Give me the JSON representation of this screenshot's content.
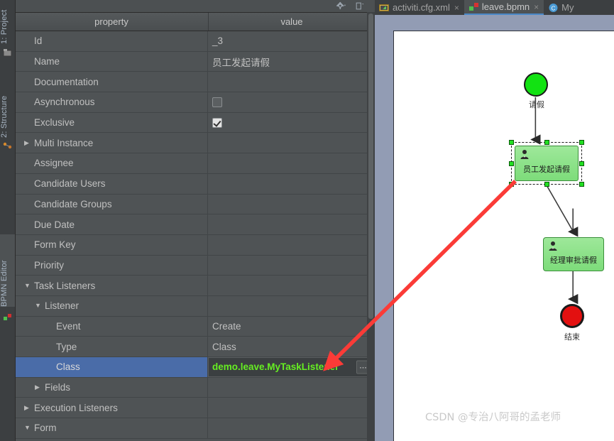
{
  "tool_strip": {
    "tabs": [
      {
        "label": "1: Project",
        "icon": "project-icon"
      },
      {
        "label": "2: Structure",
        "icon": "structure-icon"
      },
      {
        "label": "BPMN Editor",
        "icon": "bpmn-icon"
      }
    ]
  },
  "properties_panel": {
    "title_icons": [
      "gear-icon",
      "panel-layout-icon"
    ],
    "columns": {
      "property": "property",
      "value": "value"
    },
    "rows": [
      {
        "name": "Id",
        "value": "_3",
        "indent": 0,
        "twisty": "",
        "kind": "text"
      },
      {
        "name": "Name",
        "value": "员工发起请假",
        "indent": 0,
        "twisty": "",
        "kind": "text"
      },
      {
        "name": "Documentation",
        "value": "",
        "indent": 0,
        "twisty": "",
        "kind": "text"
      },
      {
        "name": "Asynchronous",
        "value": "",
        "indent": 0,
        "twisty": "",
        "kind": "checkbox-unchecked"
      },
      {
        "name": "Exclusive",
        "value": "",
        "indent": 0,
        "twisty": "",
        "kind": "checkbox-checked"
      },
      {
        "name": "Multi Instance",
        "value": "",
        "indent": 0,
        "twisty": "collapsed",
        "kind": "text"
      },
      {
        "name": "Assignee",
        "value": "",
        "indent": 0,
        "twisty": "",
        "kind": "text"
      },
      {
        "name": "Candidate Users",
        "value": "",
        "indent": 0,
        "twisty": "",
        "kind": "text"
      },
      {
        "name": "Candidate Groups",
        "value": "",
        "indent": 0,
        "twisty": "",
        "kind": "text"
      },
      {
        "name": "Due Date",
        "value": "",
        "indent": 0,
        "twisty": "",
        "kind": "text"
      },
      {
        "name": "Form Key",
        "value": "",
        "indent": 0,
        "twisty": "",
        "kind": "text"
      },
      {
        "name": "Priority",
        "value": "",
        "indent": 0,
        "twisty": "",
        "kind": "text"
      },
      {
        "name": "Task Listeners",
        "value": "",
        "indent": 0,
        "twisty": "expanded",
        "kind": "text"
      },
      {
        "name": "Listener",
        "value": "",
        "indent": 1,
        "twisty": "expanded",
        "kind": "text"
      },
      {
        "name": "Event",
        "value": "Create",
        "indent": 2,
        "twisty": "",
        "kind": "text"
      },
      {
        "name": "Type",
        "value": "Class",
        "indent": 2,
        "twisty": "",
        "kind": "text"
      },
      {
        "name": "Class",
        "value": "demo.leave.MyTaskListener",
        "indent": 2,
        "twisty": "",
        "kind": "editing",
        "selected": true,
        "ellipsis": "..."
      },
      {
        "name": "Fields",
        "value": "",
        "indent": 1,
        "twisty": "collapsed",
        "kind": "text"
      },
      {
        "name": "Execution Listeners",
        "value": "",
        "indent": 0,
        "twisty": "collapsed",
        "kind": "text"
      },
      {
        "name": "Form",
        "value": "",
        "indent": 0,
        "twisty": "expanded",
        "kind": "text"
      }
    ],
    "colors": {
      "selected_row": "#4a6ca8",
      "editing_value_text": "#66ee22",
      "panel_bg": "#4f5355"
    }
  },
  "editor": {
    "tabs": [
      {
        "label": "activiti.cfg.xml",
        "icon": "xml-file-icon",
        "active": false,
        "close": "×"
      },
      {
        "label": "leave.bpmn",
        "icon": "bpmn-file-icon",
        "active": true,
        "close": "×"
      },
      {
        "label": "My",
        "icon": "java-class-icon",
        "active": false,
        "close": ""
      }
    ]
  },
  "diagram": {
    "start_event": {
      "label": "请假",
      "color": "#12e212",
      "icon": "start-event-circle"
    },
    "task1": {
      "label": "员工发起请假",
      "color": "#8ee08a",
      "icon": "user-task-icon",
      "selected": true
    },
    "task2": {
      "label": "经理审批请假",
      "color": "#8ee08a",
      "icon": "user-task-icon",
      "selected": false
    },
    "end_event": {
      "label": "结束",
      "color": "#e31010",
      "icon": "end-event-circle"
    }
  },
  "watermark": {
    "text": "CSDN @专治八阿哥的孟老师"
  },
  "annotation": {
    "arrow_color": "#fb3b37"
  }
}
